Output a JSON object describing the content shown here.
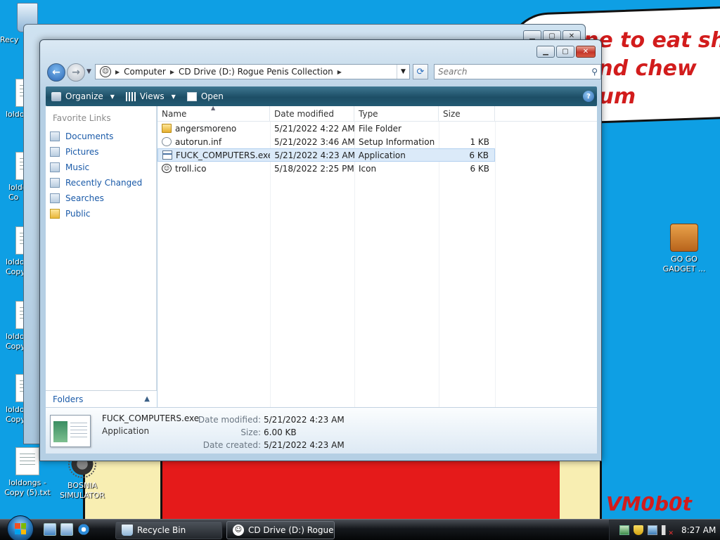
{
  "wallpaper": {
    "bubble_text": "ne to eat shit\nand chew\ngum",
    "signature": "VM0b0t"
  },
  "desktop": {
    "icons": [
      {
        "label": "Recy"
      },
      {
        "label": "loldo"
      },
      {
        "label": "loldo\nCo"
      },
      {
        "label": "loldo\nCopy"
      },
      {
        "label": "loldo\nCopy"
      },
      {
        "label": "loldo\nCopy"
      },
      {
        "label": "loldongs -\nCopy (5).txt"
      },
      {
        "label": "BOSNIA\nSIMULATOR"
      },
      {
        "label": "GO GO\nGADGET ..."
      }
    ]
  },
  "window": {
    "breadcrumb": [
      "Computer",
      "CD Drive (D:) Rogue Penis Collection"
    ],
    "search_placeholder": "Search",
    "toolbar": {
      "organize": "Organize",
      "views": "Views",
      "open": "Open",
      "help": "?"
    },
    "nav": {
      "title": "Favorite Links",
      "items": [
        {
          "label": "Documents",
          "icon": "documents-icon"
        },
        {
          "label": "Pictures",
          "icon": "pictures-icon"
        },
        {
          "label": "Music",
          "icon": "music-icon"
        },
        {
          "label": "Recently Changed",
          "icon": "recent-icon"
        },
        {
          "label": "Searches",
          "icon": "searches-icon"
        },
        {
          "label": "Public",
          "icon": "folder-icon"
        }
      ],
      "folders_label": "Folders"
    },
    "columns": {
      "name": "Name",
      "date": "Date modified",
      "type": "Type",
      "size": "Size"
    },
    "files": [
      {
        "name": "angersmoreno",
        "date": "5/21/2022 4:22 AM",
        "type": "File Folder",
        "size": "",
        "icon": "folder"
      },
      {
        "name": "autorun.inf",
        "date": "5/21/2022 3:46 AM",
        "type": "Setup Information",
        "size": "1 KB",
        "icon": "setup"
      },
      {
        "name": "FUCK_COMPUTERS.exe",
        "date": "5/21/2022 4:23 AM",
        "type": "Application",
        "size": "6 KB",
        "icon": "app"
      },
      {
        "name": "troll.ico",
        "date": "5/18/2022 2:25 PM",
        "type": "Icon",
        "size": "6 KB",
        "icon": "troll"
      }
    ],
    "selected_index": 2,
    "details": {
      "name": "FUCK_COMPUTERS.exe",
      "type": "Application",
      "date_modified_label": "Date modified:",
      "date_modified": "5/21/2022 4:23 AM",
      "size_label": "Size:",
      "size": "6.00 KB",
      "date_created_label": "Date created:",
      "date_created": "5/21/2022 4:23 AM"
    }
  },
  "taskbar": {
    "buttons": [
      {
        "label": "Recycle Bin",
        "active": false
      },
      {
        "label": "CD Drive (D:) Rogue...",
        "active": true
      }
    ],
    "clock": "8:27 AM"
  },
  "colors": {
    "desktop_bg": "#0e9fe4",
    "toolbar_bg": "#1d4e66",
    "link_blue": "#1a5aa8",
    "selection": "#dbeaf9",
    "wallpaper_red": "#e51a1a"
  }
}
